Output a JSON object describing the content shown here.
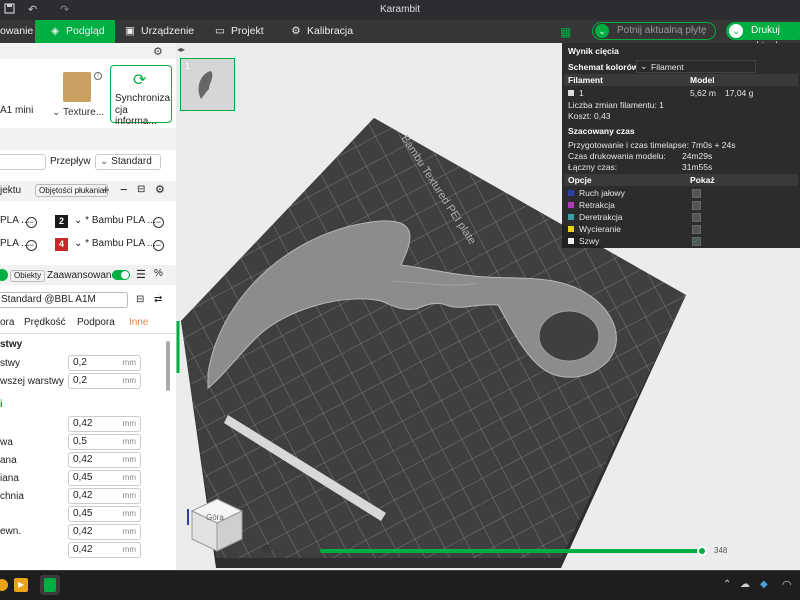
{
  "window": {
    "title": "Karambit"
  },
  "menu": {
    "tab_prepare": "owanie",
    "tab_preview": "Podgląd",
    "tab_device": "Urządzenie",
    "tab_project": "Projekt",
    "tab_calibration": "Kalibracja",
    "slice_plate": "Potnij aktualną płytę",
    "print_plate": "Drukuj aktualn"
  },
  "left": {
    "printer_name": "A1 mini",
    "plate_type": "Texture...",
    "sync_line1": "Synchroniza",
    "sync_line2": "cja informa...",
    "flow_label": "Przepływ",
    "flow_value": "Standard",
    "project_filaments": "jektu",
    "flushing_volumes": "Objętości płukania",
    "filaments": [
      {
        "left": "PLA ...",
        "num": "2",
        "color": "#1a1a1a",
        "name": "* Bambu PLA ..."
      },
      {
        "left": "PLA ...",
        "num": "4",
        "color": "#c62828",
        "name": "* Bambu PLA ..."
      }
    ],
    "objects_tab": "Obiekty",
    "advanced_label": "Zaawansowane",
    "process_preset": "Standard @BBL A1M",
    "subtabs": [
      "ora",
      "Prędkość",
      "Podpora",
      "Inne"
    ],
    "layer_section": "stwy",
    "line_section": "i",
    "unit": "mm",
    "settings": [
      {
        "label": "stwy",
        "value": "0,2"
      },
      {
        "label": "wszej warstwy",
        "value": "0,2"
      },
      {
        "label": "",
        "value": "0,42"
      },
      {
        "label": "wa",
        "value": "0,5"
      },
      {
        "label": "ana",
        "value": "0,42"
      },
      {
        "label": "iana",
        "value": "0,45"
      },
      {
        "label": "chnia",
        "value": "0,42"
      },
      {
        "label": "",
        "value": "0,45"
      },
      {
        "label": "ewn.",
        "value": "0,42"
      },
      {
        "label": "",
        "value": "0,42"
      }
    ]
  },
  "viewport": {
    "plate_number": "1",
    "plate_text": "Bambu Textured PEI plate",
    "cube_label": "Góra",
    "layer_max": "348",
    "layer_progress": 1.0
  },
  "result": {
    "title": "Wynik cięcia",
    "color_scheme_label": "Schemat kolorów",
    "color_scheme_value": "Filament",
    "col_filament": "Filament",
    "col_model": "Model",
    "filament_row_id": "1",
    "filament_row_length": "5,62 m",
    "filament_row_weight": "17,04 g",
    "filament_changes": "Liczba zmian filamentu:  1",
    "cost": "Koszt:  0,43",
    "time_title": "Szacowany czas",
    "prep_time": "Przygotowanie i czas timelapse: 7m0s + 24s",
    "model_time_label": "Czas drukowania modelu:",
    "model_time_value": "24m29s",
    "total_time_label": "Łączny czas:",
    "total_time_value": "31m55s",
    "options_label": "Opcje",
    "show_label": "Pokaż",
    "options": [
      {
        "name": "Ruch jałowy",
        "color": "#2d3fa6",
        "checked": false
      },
      {
        "name": "Retrakcja",
        "color": "#b03ab8",
        "checked": false
      },
      {
        "name": "Deretrakcja",
        "color": "#3aa0a8",
        "checked": false
      },
      {
        "name": "Wycieranie",
        "color": "#e6d31a",
        "checked": false
      },
      {
        "name": "Szwy",
        "color": "#eeeeee",
        "checked": true
      }
    ]
  },
  "colors": {
    "accent": "#00ae42",
    "dark": "#363636"
  }
}
